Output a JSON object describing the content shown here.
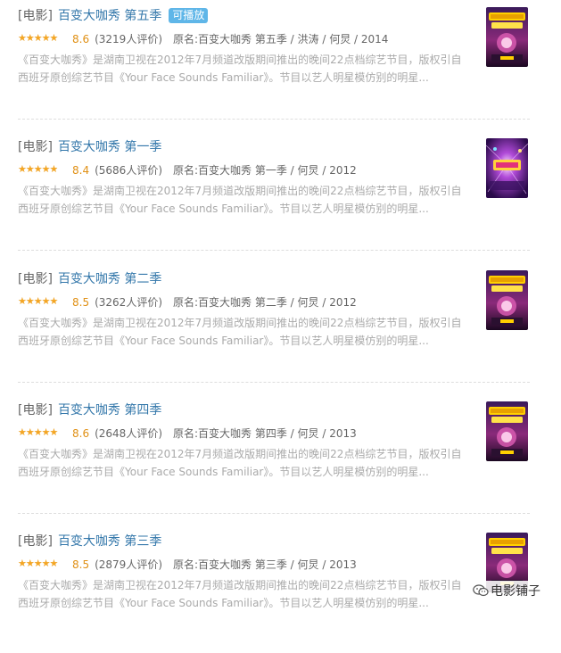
{
  "results": [
    {
      "category": "[电影]",
      "title": "百变大咖秀 第五季",
      "badge": "可播放",
      "rating": 8.6,
      "rating_text": "8.6",
      "votes": "(3219人评价)",
      "subject": "原名:百变大咖秀 第五季 / 洪涛 / 何炅 / 2014",
      "desc": "《百变大咖秀》是湖南卫视在2012年7月频道改版期间推出的晚间22点档综艺节目，版权引自西班牙原创综艺节目《Your Face Sounds Familiar》。节目以艺人明星模仿别的明星...",
      "poster_icon": "show-poster-gold-icon"
    },
    {
      "category": "[电影]",
      "title": "百变大咖秀 第一季",
      "badge": "",
      "rating": 8.4,
      "rating_text": "8.4",
      "votes": "(5686人评价)",
      "subject": "原名:百变大咖秀 第一季 / 何炅 / 2012",
      "desc": "《百变大咖秀》是湖南卫视在2012年7月频道改版期间推出的晚间22点档综艺节目，版权引自西班牙原创综艺节目《Your Face Sounds Familiar》。节目以艺人明星模仿别的明星...",
      "poster_icon": "show-poster-purple-icon"
    },
    {
      "category": "[电影]",
      "title": "百变大咖秀 第二季",
      "badge": "",
      "rating": 8.5,
      "rating_text": "8.5",
      "votes": "(3262人评价)",
      "subject": "原名:百变大咖秀 第二季 / 何炅 / 2012",
      "desc": "《百变大咖秀》是湖南卫视在2012年7月频道改版期间推出的晚间22点档综艺节目，版权引自西班牙原创综艺节目《Your Face Sounds Familiar》。节目以艺人明星模仿别的明星...",
      "poster_icon": "show-poster-gold-icon"
    },
    {
      "category": "[电影]",
      "title": "百变大咖秀 第四季",
      "badge": "",
      "rating": 8.6,
      "rating_text": "8.6",
      "votes": "(2648人评价)",
      "subject": "原名:百变大咖秀 第四季 / 何炅 / 2013",
      "desc": "《百变大咖秀》是湖南卫视在2012年7月频道改版期间推出的晚间22点档综艺节目，版权引自西班牙原创综艺节目《Your Face Sounds Familiar》。节目以艺人明星模仿别的明星...",
      "poster_icon": "show-poster-gold-icon"
    },
    {
      "category": "[电影]",
      "title": "百变大咖秀 第三季",
      "badge": "",
      "rating": 8.5,
      "rating_text": "8.5",
      "votes": "(2879人评价)",
      "subject": "原名:百变大咖秀 第三季 / 何炅 / 2013",
      "desc": "《百变大咖秀》是湖南卫视在2012年7月频道改版期间推出的晚间22点档综艺节目，版权引自西班牙原创综艺节目《Your Face Sounds Familiar》。节目以艺人明星模仿别的明星...",
      "poster_icon": "show-poster-gold-icon"
    }
  ],
  "watermark": {
    "text": "电影铺子",
    "icon": "wechat-icon"
  },
  "colors": {
    "title_link": "#3377aa",
    "badge_bg": "#5fb6e8",
    "star": "#f5a623",
    "score": "#e09015",
    "desc_text": "#aaaaaa"
  }
}
